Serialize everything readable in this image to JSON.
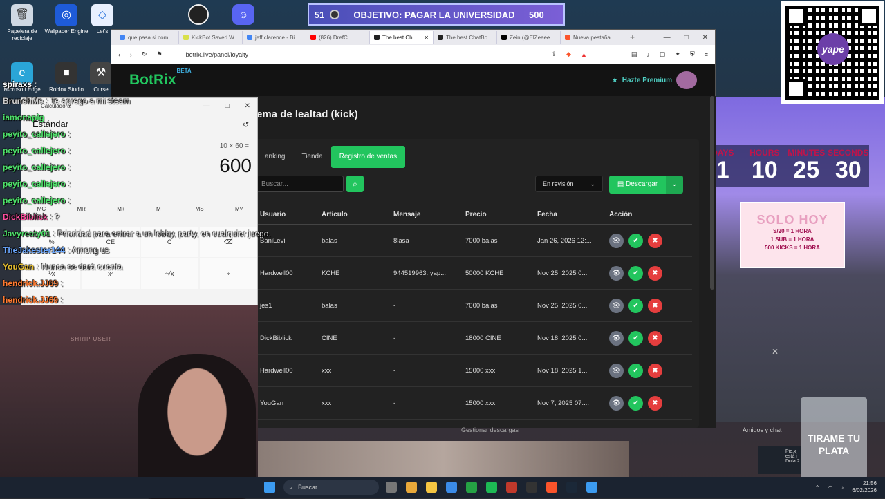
{
  "desktop_icons": [
    {
      "label": "Papelera de reciclaje",
      "icon": "recycle-bin-icon"
    },
    {
      "label": "Wallpaper Engine",
      "icon": "wallpaper-engine-icon"
    },
    {
      "label": "Let's",
      "icon": "app-icon"
    },
    {
      "label": "Microsoft Edge",
      "icon": "edge-icon"
    },
    {
      "label": "Roblox Studio",
      "icon": "roblox-icon"
    },
    {
      "label": "Curse",
      "icon": "curseforge-icon"
    }
  ],
  "goal": {
    "count": "51",
    "text": "OBJETIVO: PAGAR LA UNIVERSIDAD",
    "amount": "500"
  },
  "qr": {
    "brand": "yape"
  },
  "countdown": [
    {
      "label": "DAYS",
      "value": "1"
    },
    {
      "label": "HOURS",
      "value": "10"
    },
    {
      "label": "MINUTES",
      "value": "25"
    },
    {
      "label": "SECONDS",
      "value": "30"
    }
  ],
  "promo": {
    "title": "SOLO HOY",
    "lines": [
      "S/20 = 1 HORA",
      "1 SUB = 1 HORA",
      "500 KICKS = 1 HORA"
    ]
  },
  "browser": {
    "tabs": [
      {
        "label": "que pasa si com",
        "color": "#4285f4"
      },
      {
        "label": "KickBot Saved W",
        "color": "#d8e04a"
      },
      {
        "label": "jeff clarence - Bi",
        "color": "#4285f4"
      },
      {
        "label": "(826) DrefCi",
        "color": "#ff0000"
      },
      {
        "label": "The best Ch",
        "color": "#222222"
      },
      {
        "label": "The best ChatBo",
        "color": "#222222"
      },
      {
        "label": "Zein (@ElZeeee",
        "color": "#000000"
      },
      {
        "label": "Nueva pestaña",
        "color": "#fb542b"
      }
    ],
    "url": "botrix.live/panel/loyalty"
  },
  "site": {
    "logo": "BotRix",
    "beta": "BETA",
    "premium": "Hazte Premium",
    "page_title": "ema de lealtad (kick)",
    "subtabs": [
      "anking",
      "Tienda",
      "Registro de ventas"
    ],
    "search_placeholder": "Buscar...",
    "filter": "En revisión",
    "download": "Descargar",
    "columns": [
      "Usuario",
      "Articulo",
      "Mensaje",
      "Precio",
      "Fecha",
      "Acción"
    ],
    "rows": [
      {
        "user": "BaniLevi",
        "item": "balas",
        "msg": "8lasa",
        "price": "7000 balas",
        "date": "Jan 26, 2026 12:..."
      },
      {
        "user": "Hardwell00",
        "item": "KCHE",
        "msg": "944519963. yap...",
        "price": "50000 KCHE",
        "date": "Nov 25, 2025 0..."
      },
      {
        "user": "jes1",
        "item": "balas",
        "msg": "-",
        "price": "7000 balas",
        "date": "Nov 25, 2025 0..."
      },
      {
        "user": "DickBiblick",
        "item": "CINE",
        "msg": "-",
        "price": "18000 CINE",
        "date": "Nov 18, 2025 0..."
      },
      {
        "user": "Hardwell00",
        "item": "xxx",
        "msg": "-",
        "price": "15000 xxx",
        "date": "Nov 18, 2025 1..."
      },
      {
        "user": "YouGan",
        "item": "xxx",
        "msg": "-",
        "price": "15000 xxx",
        "date": "Nov 7, 2025 07:..."
      }
    ]
  },
  "calculator": {
    "title": "Calculadora",
    "mode": "Estándar",
    "expression": "10 × 60 =",
    "result": "600",
    "memory": [
      "MC",
      "MR",
      "M+",
      "M−",
      "MS",
      "M˅"
    ],
    "keys": [
      "%",
      "CE",
      "C",
      "⌫",
      "⅟x",
      "x²",
      "²√x",
      "÷"
    ]
  },
  "chat": [
    {
      "user": "spiraxs",
      "text": ":",
      "color": "#ffffff"
    },
    {
      "user": "BrunehMe",
      "text": ": Te agrego a mi steam",
      "color": "#cccccc"
    },
    {
      "user": "iamonapig",
      "text": "",
      "color": "#4ee06a"
    },
    {
      "user": "peyito_callejero",
      "text": ":",
      "color": "#4ee06a"
    },
    {
      "user": "peyito_callejero",
      "text": ":",
      "color": "#4ee06a"
    },
    {
      "user": "peyito_callejero",
      "text": ":",
      "color": "#4ee06a"
    },
    {
      "user": "peyito_callejero",
      "text": ":",
      "color": "#4ee06a"
    },
    {
      "user": "peyito_callejero",
      "text": ":",
      "color": "#4ee06a"
    },
    {
      "user": "DickBiblick",
      "text": ": ?",
      "color": "#ff4fa0"
    },
    {
      "user": "Javyreaty01",
      "text": ": Prioridad para entrar a un lobby, party, en cualquier juego.",
      "color": "#4ee06a"
    },
    {
      "user": "TheJakester144",
      "text": ": Among us",
      "color": "#6aa7ff"
    },
    {
      "user": "YouGan",
      "text": ": Nunca se dará cuenta",
      "color": "#e8c030"
    },
    {
      "user": "hendrick.JJ69",
      "text": ":",
      "color": "#ff7a30"
    },
    {
      "user": "hendrick.JJ69",
      "text": ":",
      "color": "#ff7a30"
    }
  ],
  "webcam": {
    "wall_text": "SHRIP USER"
  },
  "glass": {
    "text": "TIRAME TU PLATA"
  },
  "steam": {
    "downloads": "Gestionar descargas",
    "friends": "Amigos y chat"
  },
  "notification": {
    "name": "Pio.x",
    "line1": "está j",
    "line2": "Dota 2"
  },
  "taskbar": {
    "search": "Buscar",
    "apps": [
      "#777777",
      "#e8a83a",
      "#f5c542",
      "#3b8be8",
      "#25a244",
      "#1db954",
      "#c0392b",
      "#333333",
      "#fb542b",
      "#1b2838",
      "#3c9bf0"
    ],
    "time": "21:56",
    "date": "6/02/2026"
  }
}
